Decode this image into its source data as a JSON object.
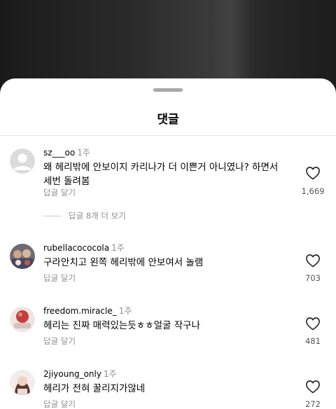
{
  "sheet": {
    "title": "댓글"
  },
  "comments": [
    {
      "username": "sz___oo",
      "time": "1주",
      "text": "왜 헤리밖에 안보이지 카리나가 더 이쁜거 아니였나? 하면서 세번 돌려봄",
      "reply_label": "답글 달기",
      "likes": "1,669",
      "view_replies": "답글 8개 더 보기"
    },
    {
      "username": "rubellacococola",
      "time": "1주",
      "text": "구라안치고 왼쪽 헤리밖에 안보여서 놀램",
      "reply_label": "답글 달기",
      "likes": "703"
    },
    {
      "username": "freedom.miracle_",
      "time": "1주",
      "text": "헤리는 진짜 매력있는듯ㅎㅎ얼굴 작구나",
      "reply_label": "답글 달기",
      "likes": "481"
    },
    {
      "username": "2jiyoung_only",
      "time": "1주",
      "text": "헤리가 전혀 꿀리지가않네",
      "reply_label": "답글 달기",
      "likes": "272"
    }
  ]
}
